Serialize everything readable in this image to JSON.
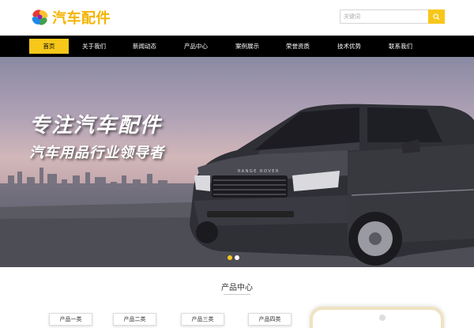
{
  "logo": {
    "text": "汽车配件"
  },
  "search": {
    "placeholder": "关键词",
    "icon": "search-icon"
  },
  "nav": {
    "items": [
      {
        "label": "首页",
        "active": true
      },
      {
        "label": "关于我们"
      },
      {
        "label": "新闻动态"
      },
      {
        "label": "产品中心"
      },
      {
        "label": "案例展示"
      },
      {
        "label": "荣誉资质"
      },
      {
        "label": "技术优势"
      },
      {
        "label": "联系我们"
      }
    ]
  },
  "banner": {
    "title": "专注汽车配件",
    "subtitle": "汽车用品行业领导者",
    "car_badge": "RANGE ROVER",
    "slides": 2,
    "active_slide": 1
  },
  "products": {
    "title": "产品中心",
    "categories": [
      "产品一类",
      "产品二类",
      "产品三类",
      "产品四类"
    ]
  },
  "colors": {
    "accent": "#f7c71a",
    "nav_bg": "#000000"
  }
}
